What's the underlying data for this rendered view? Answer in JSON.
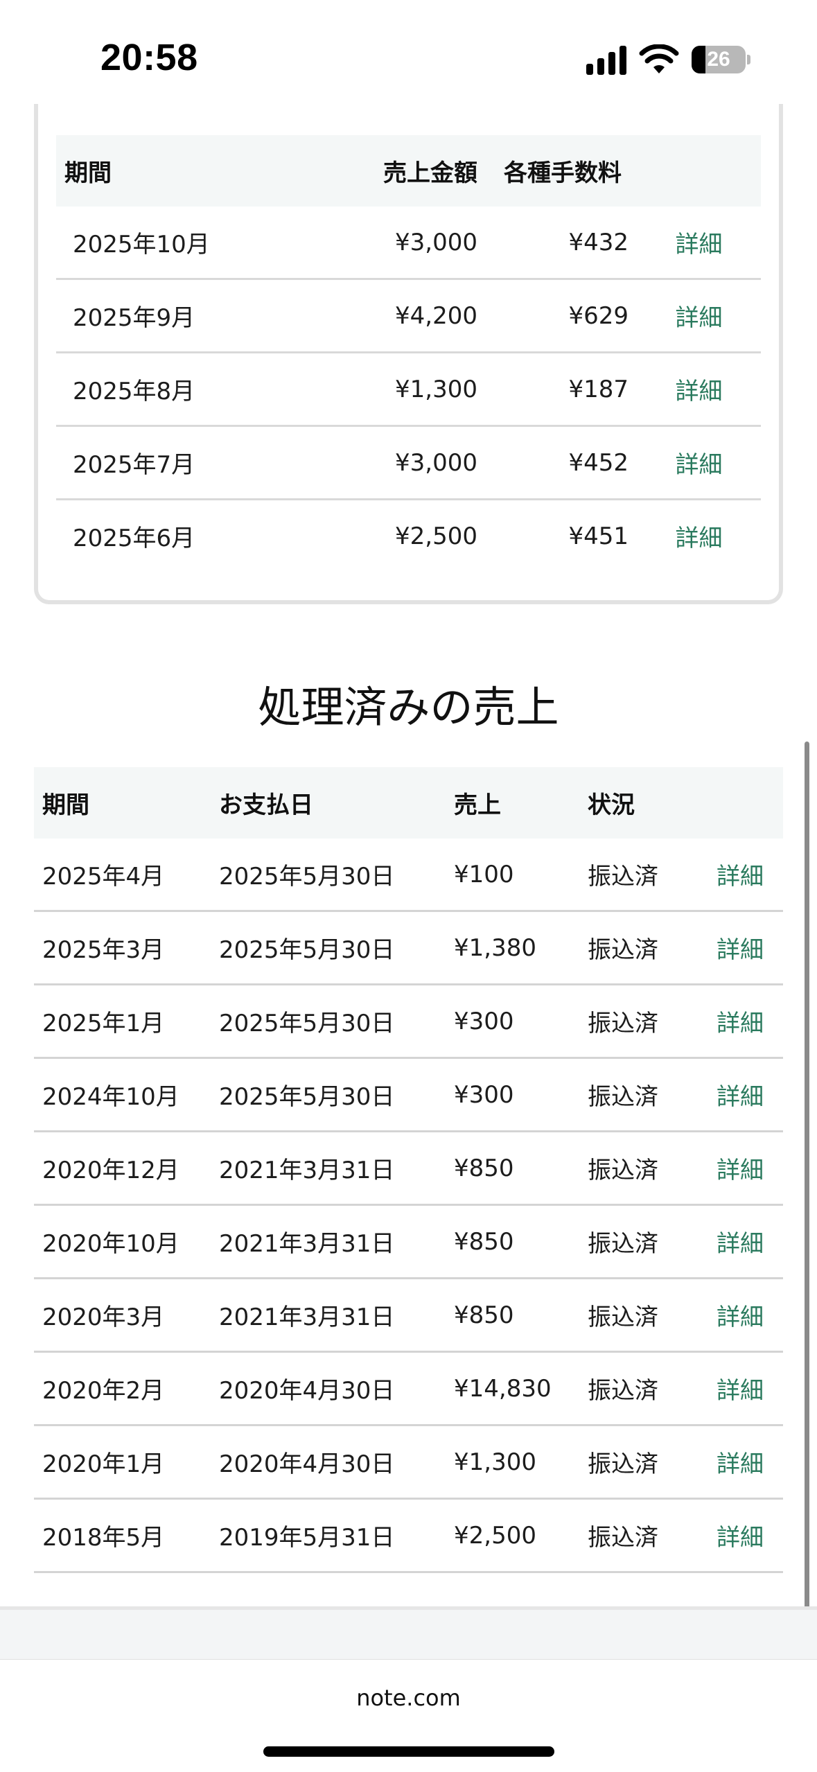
{
  "status_bar": {
    "time": "20:58",
    "battery_level": "26",
    "battery_fraction": 0.26
  },
  "pending_sales": {
    "headers": [
      "期間",
      "売上金額",
      "各種手数料",
      ""
    ],
    "rows": [
      {
        "period": "2025年10月",
        "amount": "¥3,000",
        "fees": "¥432",
        "detail": "詳細"
      },
      {
        "period": "2025年9月",
        "amount": "¥4,200",
        "fees": "¥629",
        "detail": "詳細"
      },
      {
        "period": "2025年8月",
        "amount": "¥1,300",
        "fees": "¥187",
        "detail": "詳細"
      },
      {
        "period": "2025年7月",
        "amount": "¥3,000",
        "fees": "¥452",
        "detail": "詳細"
      },
      {
        "period": "2025年6月",
        "amount": "¥2,500",
        "fees": "¥451",
        "detail": "詳細"
      }
    ]
  },
  "processed_sales": {
    "title": "処理済みの売上",
    "headers": [
      "期間",
      "お支払日",
      "売上",
      "状況",
      ""
    ],
    "rows": [
      {
        "period": "2025年4月",
        "pay_date": "2025年5月30日",
        "sales": "¥100",
        "status": "振込済",
        "detail": "詳細"
      },
      {
        "period": "2025年3月",
        "pay_date": "2025年5月30日",
        "sales": "¥1,380",
        "status": "振込済",
        "detail": "詳細"
      },
      {
        "period": "2025年1月",
        "pay_date": "2025年5月30日",
        "sales": "¥300",
        "status": "振込済",
        "detail": "詳細"
      },
      {
        "period": "2024年10月",
        "pay_date": "2025年5月30日",
        "sales": "¥300",
        "status": "振込済",
        "detail": "詳細"
      },
      {
        "period": "2020年12月",
        "pay_date": "2021年3月31日",
        "sales": "¥850",
        "status": "振込済",
        "detail": "詳細"
      },
      {
        "period": "2020年10月",
        "pay_date": "2021年3月31日",
        "sales": "¥850",
        "status": "振込済",
        "detail": "詳細"
      },
      {
        "period": "2020年3月",
        "pay_date": "2021年3月31日",
        "sales": "¥850",
        "status": "振込済",
        "detail": "詳細"
      },
      {
        "period": "2020年2月",
        "pay_date": "2020年4月30日",
        "sales": "¥14,830",
        "status": "振込済",
        "detail": "詳細"
      },
      {
        "period": "2020年1月",
        "pay_date": "2020年4月30日",
        "sales": "¥1,300",
        "status": "振込済",
        "detail": "詳細"
      },
      {
        "period": "2018年5月",
        "pay_date": "2019年5月31日",
        "sales": "¥2,500",
        "status": "振込済",
        "detail": "詳細"
      }
    ]
  },
  "browser": {
    "url": "note.com"
  },
  "colors": {
    "link": "#2a7a5e",
    "header_bg": "#f4f7f7",
    "row_border": "#d9d9d9"
  }
}
